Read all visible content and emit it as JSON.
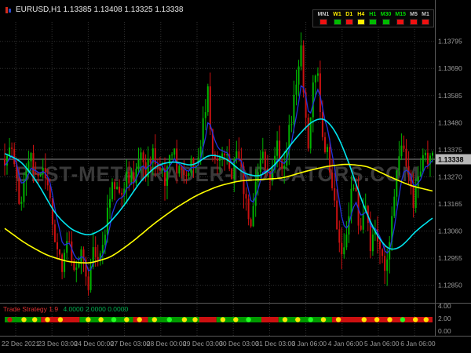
{
  "header": {
    "symbol_info": "EURUSD,H1  1.13385 1.13408 1.13325 1.13338"
  },
  "watermark": "BEST-METATRADER-INDICATORS.COM",
  "tf_panel": {
    "items": [
      {
        "label": "MN1",
        "label_color": "#c8c8c8",
        "square_color": "#ee1111"
      },
      {
        "label": "W1",
        "label_color": "#ffee00",
        "square_color": "#00bb00"
      },
      {
        "label": "D1",
        "label_color": "#ffee00",
        "square_color": "#ee1111"
      },
      {
        "label": "H4",
        "label_color": "#ffee00",
        "square_color": "#ffee00"
      },
      {
        "label": "H1",
        "label_color": "#00dd00",
        "square_color": "#00bb00"
      },
      {
        "label": "M30",
        "label_color": "#00dd00",
        "square_color": "#00bb00"
      },
      {
        "label": "M15",
        "label_color": "#00dd00",
        "square_color": "#ee1111"
      },
      {
        "label": "M5",
        "label_color": "#c8c8c8",
        "square_color": "#ee1111"
      },
      {
        "label": "M1",
        "label_color": "#c8c8c8",
        "square_color": "#ee1111"
      }
    ]
  },
  "price_scale": {
    "ticks": [
      "1.13795",
      "1.13690",
      "1.13585",
      "1.13480",
      "1.13375",
      "1.13270",
      "1.13165",
      "1.13060",
      "1.12955",
      "1.12850"
    ],
    "current": "1.13338"
  },
  "time_axis": {
    "labels": [
      "22 Dec 2021",
      "23 Dec 03:00",
      "24 Dec 00:00",
      "27 Dec 03:00",
      "28 Dec 00:00",
      "29 Dec 03:00",
      "30 Dec 03:00",
      "31 Dec 03:00",
      "3 Jan 06:00",
      "4 Jan 06:00",
      "5 Jan 06:00",
      "6 Jan 06:00"
    ]
  },
  "indicator": {
    "name": "Trade Strategy 1.9",
    "values": "4.0000 2.0000 0.0000",
    "scale": [
      "4.00",
      "2.00",
      "0.00"
    ],
    "colors": {
      "green": "#009a00",
      "red": "#cc1010",
      "yellow": "#ffe400",
      "lime": "#22ff22"
    },
    "segments": [
      {
        "s": 0.0,
        "e": 0.085,
        "c": "green"
      },
      {
        "s": 0.085,
        "e": 0.175,
        "c": "red"
      },
      {
        "s": 0.175,
        "e": 0.3,
        "c": "green"
      },
      {
        "s": 0.3,
        "e": 0.335,
        "c": "red"
      },
      {
        "s": 0.335,
        "e": 0.455,
        "c": "green"
      },
      {
        "s": 0.455,
        "e": 0.495,
        "c": "red"
      },
      {
        "s": 0.495,
        "e": 0.6,
        "c": "green"
      },
      {
        "s": 0.6,
        "e": 0.64,
        "c": "red"
      },
      {
        "s": 0.64,
        "e": 0.765,
        "c": "green"
      },
      {
        "s": 0.765,
        "e": 1.0,
        "c": "red"
      }
    ],
    "dots": [
      {
        "x": 0.012,
        "c": "red"
      },
      {
        "x": 0.045,
        "c": "yellow"
      },
      {
        "x": 0.07,
        "c": "yellow"
      },
      {
        "x": 0.1,
        "c": "yellow"
      },
      {
        "x": 0.13,
        "c": "yellow"
      },
      {
        "x": 0.16,
        "c": "red"
      },
      {
        "x": 0.195,
        "c": "yellow"
      },
      {
        "x": 0.225,
        "c": "yellow"
      },
      {
        "x": 0.255,
        "c": "lime"
      },
      {
        "x": 0.285,
        "c": "yellow"
      },
      {
        "x": 0.315,
        "c": "yellow"
      },
      {
        "x": 0.35,
        "c": "yellow"
      },
      {
        "x": 0.385,
        "c": "lime"
      },
      {
        "x": 0.42,
        "c": "yellow"
      },
      {
        "x": 0.445,
        "c": "yellow"
      },
      {
        "x": 0.47,
        "c": "red"
      },
      {
        "x": 0.51,
        "c": "yellow"
      },
      {
        "x": 0.54,
        "c": "yellow"
      },
      {
        "x": 0.57,
        "c": "lime"
      },
      {
        "x": 0.615,
        "c": "red"
      },
      {
        "x": 0.655,
        "c": "yellow"
      },
      {
        "x": 0.685,
        "c": "yellow"
      },
      {
        "x": 0.715,
        "c": "lime"
      },
      {
        "x": 0.745,
        "c": "yellow"
      },
      {
        "x": 0.78,
        "c": "yellow"
      },
      {
        "x": 0.81,
        "c": "red"
      },
      {
        "x": 0.84,
        "c": "yellow"
      },
      {
        "x": 0.87,
        "c": "yellow"
      },
      {
        "x": 0.9,
        "c": "yellow"
      },
      {
        "x": 0.93,
        "c": "lime"
      },
      {
        "x": 0.96,
        "c": "yellow"
      },
      {
        "x": 0.985,
        "c": "yellow"
      }
    ]
  },
  "chart_data": {
    "type": "candlestick",
    "symbol": "EURUSD",
    "timeframe": "H1",
    "title": "EURUSD,H1",
    "ohlc_header": {
      "open": 1.13385,
      "high": 1.13408,
      "low": 1.13325,
      "close": 1.13338
    },
    "current_price": 1.13338,
    "price_range": [
      1.12785,
      1.1387
    ],
    "y_ticks": [
      "1.13795",
      "1.13690",
      "1.13585",
      "1.13480",
      "1.13375",
      "1.13270",
      "1.13165",
      "1.13060",
      "1.12955",
      "1.12850"
    ],
    "x_labels": [
      "22 Dec 2021",
      "23 Dec 03:00",
      "24 Dec 00:00",
      "27 Dec 03:00",
      "28 Dec 00:00",
      "29 Dec 03:00",
      "30 Dec 03:00",
      "31 Dec 03:00",
      "3 Jan 06:00",
      "4 Jan 06:00",
      "5 Jan 06:00",
      "6 Jan 06:00"
    ],
    "up_color": "#00b300",
    "down_color": "#cc1111",
    "candles_count": 180,
    "close_path_anchors": [
      [
        0.0,
        1.1334
      ],
      [
        0.01,
        1.134
      ],
      [
        0.022,
        1.1333
      ],
      [
        0.035,
        1.1315
      ],
      [
        0.045,
        1.1328
      ],
      [
        0.06,
        1.1336
      ],
      [
        0.075,
        1.1325
      ],
      [
        0.09,
        1.1332
      ],
      [
        0.105,
        1.1318
      ],
      [
        0.12,
        1.13
      ],
      [
        0.135,
        1.129
      ],
      [
        0.15,
        1.1305
      ],
      [
        0.165,
        1.1288
      ],
      [
        0.18,
        1.1298
      ],
      [
        0.195,
        1.1286
      ],
      [
        0.21,
        1.13
      ],
      [
        0.225,
        1.1294
      ],
      [
        0.24,
        1.1312
      ],
      [
        0.255,
        1.1325
      ],
      [
        0.27,
        1.1318
      ],
      [
        0.285,
        1.133
      ],
      [
        0.3,
        1.1324
      ],
      [
        0.315,
        1.1335
      ],
      [
        0.33,
        1.1328
      ],
      [
        0.345,
        1.1338
      ],
      [
        0.36,
        1.133
      ],
      [
        0.375,
        1.1325
      ],
      [
        0.39,
        1.1338
      ],
      [
        0.405,
        1.133
      ],
      [
        0.42,
        1.1326
      ],
      [
        0.435,
        1.1334
      ],
      [
        0.45,
        1.133
      ],
      [
        0.465,
        1.1348
      ],
      [
        0.475,
        1.1359
      ],
      [
        0.485,
        1.1337
      ],
      [
        0.5,
        1.133
      ],
      [
        0.515,
        1.1336
      ],
      [
        0.53,
        1.1327
      ],
      [
        0.545,
        1.1339
      ],
      [
        0.56,
        1.1318
      ],
      [
        0.575,
        1.131
      ],
      [
        0.59,
        1.1328
      ],
      [
        0.605,
        1.1335
      ],
      [
        0.62,
        1.1328
      ],
      [
        0.635,
        1.134
      ],
      [
        0.65,
        1.1331
      ],
      [
        0.665,
        1.1345
      ],
      [
        0.68,
        1.136
      ],
      [
        0.692,
        1.1378
      ],
      [
        0.7,
        1.1356
      ],
      [
        0.71,
        1.134
      ],
      [
        0.72,
        1.1365
      ],
      [
        0.73,
        1.137
      ],
      [
        0.742,
        1.1345
      ],
      [
        0.755,
        1.1335
      ],
      [
        0.768,
        1.132
      ],
      [
        0.78,
        1.1305
      ],
      [
        0.792,
        1.1298
      ],
      [
        0.805,
        1.1315
      ],
      [
        0.818,
        1.1328
      ],
      [
        0.83,
        1.1305
      ],
      [
        0.842,
        1.1315
      ],
      [
        0.855,
        1.13
      ],
      [
        0.868,
        1.1308
      ],
      [
        0.88,
        1.1296
      ],
      [
        0.892,
        1.129
      ],
      [
        0.905,
        1.131
      ],
      [
        0.918,
        1.1332
      ],
      [
        0.93,
        1.134
      ],
      [
        0.942,
        1.1331
      ],
      [
        0.955,
        1.1315
      ],
      [
        0.968,
        1.1328
      ],
      [
        0.98,
        1.1336
      ],
      [
        1.0,
        1.13338
      ]
    ],
    "ma_fast_blue": {
      "period": 6,
      "color": "#2233dd"
    },
    "ma_medium_cyan": {
      "color": "#00e5ee",
      "anchors": [
        [
          0.0,
          1.1336
        ],
        [
          0.04,
          1.1333
        ],
        [
          0.08,
          1.1324
        ],
        [
          0.12,
          1.1312
        ],
        [
          0.16,
          1.1306
        ],
        [
          0.2,
          1.1304
        ],
        [
          0.24,
          1.1308
        ],
        [
          0.28,
          1.1316
        ],
        [
          0.32,
          1.1326
        ],
        [
          0.36,
          1.1332
        ],
        [
          0.4,
          1.1333
        ],
        [
          0.44,
          1.1331
        ],
        [
          0.48,
          1.1336
        ],
        [
          0.52,
          1.1334
        ],
        [
          0.56,
          1.1328
        ],
        [
          0.6,
          1.1327
        ],
        [
          0.64,
          1.1333
        ],
        [
          0.68,
          1.1342
        ],
        [
          0.72,
          1.1349
        ],
        [
          0.75,
          1.135
        ],
        [
          0.78,
          1.1343
        ],
        [
          0.81,
          1.133
        ],
        [
          0.84,
          1.1315
        ],
        [
          0.87,
          1.1304
        ],
        [
          0.9,
          1.1298
        ],
        [
          0.93,
          1.13
        ],
        [
          0.96,
          1.1306
        ],
        [
          1.0,
          1.1311
        ]
      ]
    },
    "ma_slow_yellow": {
      "color": "#ffff00",
      "anchors": [
        [
          0.0,
          1.1307
        ],
        [
          0.05,
          1.1301
        ],
        [
          0.1,
          1.12965
        ],
        [
          0.15,
          1.1294
        ],
        [
          0.2,
          1.12935
        ],
        [
          0.25,
          1.1296
        ],
        [
          0.3,
          1.1302
        ],
        [
          0.35,
          1.1309
        ],
        [
          0.4,
          1.1315
        ],
        [
          0.45,
          1.132
        ],
        [
          0.5,
          1.13235
        ],
        [
          0.55,
          1.13255
        ],
        [
          0.6,
          1.1326
        ],
        [
          0.65,
          1.13265
        ],
        [
          0.7,
          1.1329
        ],
        [
          0.75,
          1.1331
        ],
        [
          0.8,
          1.1332
        ],
        [
          0.85,
          1.1331
        ],
        [
          0.9,
          1.1327
        ],
        [
          0.95,
          1.13235
        ],
        [
          1.0,
          1.13215
        ]
      ]
    }
  }
}
